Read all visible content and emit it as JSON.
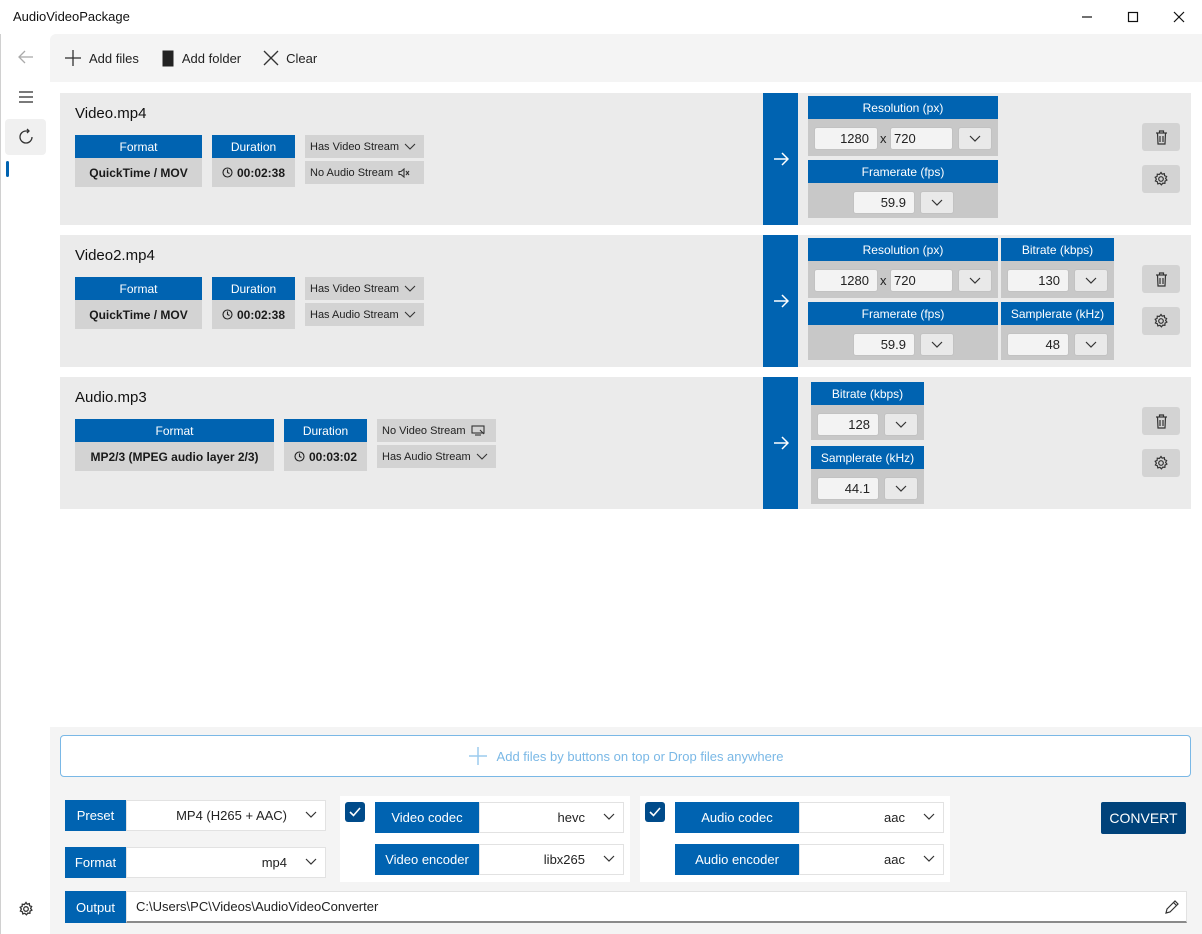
{
  "window": {
    "title": "AudioVideoPackage"
  },
  "toolbar": {
    "add_files": "Add files",
    "add_folder": "Add folder",
    "clear": "Clear"
  },
  "files": [
    {
      "name": "Video.mp4",
      "format_header": "Format",
      "format": "QuickTime / MOV",
      "duration_header": "Duration",
      "duration": "00:02:38",
      "video_stream": "Has Video Stream",
      "audio_stream": "No Audio Stream",
      "resolution_header": "Resolution (px)",
      "width": "1280",
      "height": "720",
      "framerate_header": "Framerate (fps)",
      "framerate": "59.9"
    },
    {
      "name": "Video2.mp4",
      "format_header": "Format",
      "format": "QuickTime / MOV",
      "duration_header": "Duration",
      "duration": "00:02:38",
      "video_stream": "Has Video Stream",
      "audio_stream": "Has Audio Stream",
      "resolution_header": "Resolution (px)",
      "width": "1280",
      "height": "720",
      "framerate_header": "Framerate (fps)",
      "framerate": "59.9",
      "bitrate_header": "Bitrate (kbps)",
      "bitrate": "130",
      "samplerate_header": "Samplerate (kHz)",
      "samplerate": "48"
    },
    {
      "name": "Audio.mp3",
      "format_header": "Format",
      "format": "MP2/3 (MPEG audio layer 2/3)",
      "duration_header": "Duration",
      "duration": "00:03:02",
      "video_stream": "No Video Stream",
      "audio_stream": "Has Audio Stream",
      "bitrate_header": "Bitrate (kbps)",
      "bitrate": "128",
      "samplerate_header": "Samplerate (kHz)",
      "samplerate": "44.1"
    }
  ],
  "dropzone": {
    "text": "Add files by buttons on top or Drop files anywhere"
  },
  "settings": {
    "preset_label": "Preset",
    "preset_value": "MP4 (H265 + AAC)",
    "format_label": "Format",
    "format_value": "mp4",
    "video_enabled": true,
    "video_codec_label": "Video codec",
    "video_codec_value": "hevc",
    "video_encoder_label": "Video encoder",
    "video_encoder_value": "libx265",
    "audio_enabled": true,
    "audio_codec_label": "Audio codec",
    "audio_codec_value": "aac",
    "audio_encoder_label": "Audio encoder",
    "audio_encoder_value": "aac",
    "convert_label": "CONVERT",
    "output_label": "Output",
    "output_path": "C:\\Users\\PC\\Videos\\AudioVideoConverter"
  },
  "colors": {
    "accent": "#0063b1",
    "accent_dark": "#00427a",
    "card_bg": "#ebebeb",
    "dropzone_text": "#7ab8e6"
  }
}
